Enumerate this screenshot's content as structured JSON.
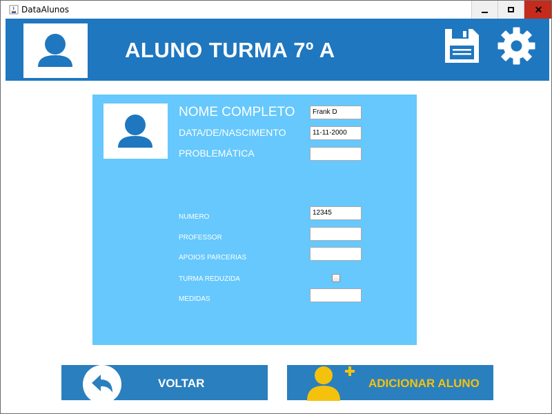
{
  "window": {
    "title": "DataAlunos",
    "controls": {
      "minimize": "▁",
      "maximize": "☐",
      "close": "✕"
    }
  },
  "header": {
    "title": "ALUNO TURMA 7º A",
    "bg_color": "#1f77bf",
    "icons": {
      "avatar": "user-icon",
      "save": "floppy-disk-icon",
      "settings": "gear-icon"
    }
  },
  "form": {
    "bg_color": "#66c8fc",
    "fields": {
      "nome_completo": {
        "label": "NOME COMPLETO",
        "value": "Frank D"
      },
      "data_nascimento": {
        "label": "DATA/DE/NASCIMENTO",
        "value": "11-11-2000"
      },
      "problematica": {
        "label": "PROBLEMÁTICA",
        "value": ""
      },
      "numero": {
        "label": "NUMERO",
        "value": "12345"
      },
      "professor": {
        "label": "PROFESSOR",
        "value": ""
      },
      "apoios_parcerias": {
        "label": "APOIOS PARCERIAS",
        "value": ""
      },
      "turma_reduzida": {
        "label": "TURMA REDUZIDA",
        "checked": false
      },
      "medidas": {
        "label": "MEDIDAS",
        "value": ""
      }
    }
  },
  "buttons": {
    "voltar": {
      "label": "VOLTAR",
      "icon": "back-arrow-icon"
    },
    "adicionar": {
      "label": "ADICIONAR ALUNO",
      "icon": "add-user-icon",
      "label_color": "#f4c20d"
    }
  }
}
